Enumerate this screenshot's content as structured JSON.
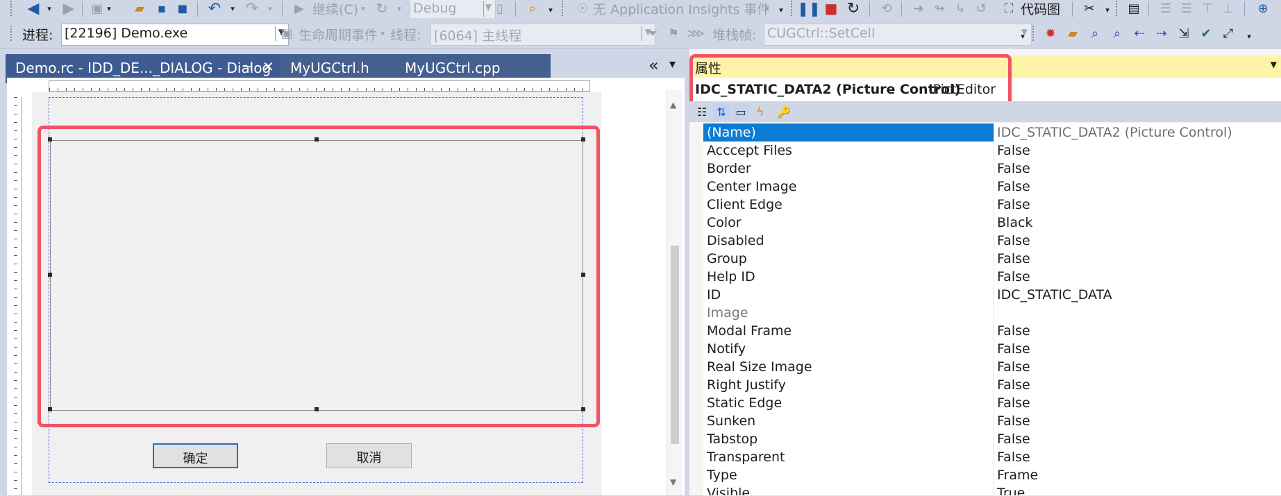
{
  "toolbar1": {
    "continue_label": "继续(C)",
    "config_value": "Debug",
    "insights_label": "无 Application Insights 事件",
    "codemap_label": "代码图"
  },
  "toolbar2": {
    "process_label": "进程:",
    "process_value": "[22196] Demo.exe",
    "lifecycle_label": "生命周期事件",
    "thread_label": "线程:",
    "thread_value": "[6064] 主线程",
    "stackframe_label": "堆栈帧:",
    "stackframe_value": "CUGCtrl::SetCell"
  },
  "tabs": [
    {
      "label": "Demo.rc - IDD_DE..._DIALOG - Dialog",
      "pin": "⊣",
      "close": "✕"
    },
    {
      "label": "MyUGCtrl.h"
    },
    {
      "label": "MyUGCtrl.cpp"
    }
  ],
  "tab_overflow": "«",
  "tab_menu": "▾",
  "dialog": {
    "ok_label": "确定",
    "cancel_label": "取消"
  },
  "properties": {
    "title": "属性",
    "object_name": "IDC_STATIC_DATA2 (Picture Control)",
    "object_type": "IPictEditor",
    "rows": [
      {
        "name": "(Name)",
        "value": "IDC_STATIC_DATA2 (Picture Control)"
      },
      {
        "name": "Acccept Files",
        "value": "False"
      },
      {
        "name": "Border",
        "value": "False"
      },
      {
        "name": "Center Image",
        "value": "False"
      },
      {
        "name": "Client Edge",
        "value": "False"
      },
      {
        "name": "Color",
        "value": "Black"
      },
      {
        "name": "Disabled",
        "value": "False"
      },
      {
        "name": "Group",
        "value": "False"
      },
      {
        "name": "Help ID",
        "value": "False"
      },
      {
        "name": "ID",
        "value": "IDC_STATIC_DATA"
      },
      {
        "name": "Image",
        "value": ""
      },
      {
        "name": "Modal Frame",
        "value": "False"
      },
      {
        "name": "Notify",
        "value": "False"
      },
      {
        "name": "Real Size Image",
        "value": "False"
      },
      {
        "name": "Right Justify",
        "value": "False"
      },
      {
        "name": "Static Edge",
        "value": "False"
      },
      {
        "name": "Sunken",
        "value": "False"
      },
      {
        "name": "Tabstop",
        "value": "False"
      },
      {
        "name": "Transparent",
        "value": "False"
      },
      {
        "name": "Type",
        "value": "Frame"
      },
      {
        "name": "Visible",
        "value": "True"
      }
    ]
  },
  "colors": {
    "highlight_red": "#f05463",
    "selection_blue": "#0b7bd4",
    "header_yellow": "#fdf4a7",
    "tab_blue": "#3e5c92"
  }
}
